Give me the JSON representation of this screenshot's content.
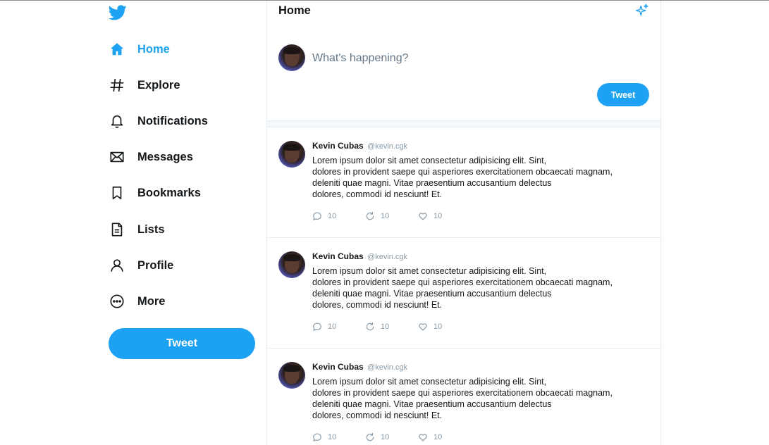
{
  "sidebar": {
    "items": [
      {
        "label": "Home",
        "icon": "home-icon"
      },
      {
        "label": "Explore",
        "icon": "hashtag-icon"
      },
      {
        "label": "Notifications",
        "icon": "bell-icon"
      },
      {
        "label": "Messages",
        "icon": "envelope-icon"
      },
      {
        "label": "Bookmarks",
        "icon": "bookmark-icon"
      },
      {
        "label": "Lists",
        "icon": "document-icon"
      },
      {
        "label": "Profile",
        "icon": "user-icon"
      },
      {
        "label": "More",
        "icon": "more-icon"
      }
    ],
    "tweet_button": "Tweet"
  },
  "header": {
    "title": "Home"
  },
  "composer": {
    "placeholder": "What's happening?",
    "tweet_button": "Tweet"
  },
  "colors": {
    "accent": "#1da1f2",
    "text": "#14171a",
    "muted": "#8899a6"
  },
  "tweets": [
    {
      "name": "Kevin Cubas",
      "handle": "@kevin.cgk",
      "lines": [
        "Lorem ipsum dolor sit amet consectetur adipisicing elit. Sint,",
        "dolores in provident saepe qui asperiores exercitationem obcaecati magnam,",
        "deleniti quae magni. Vitae praesentium accusantium delectus",
        "dolores, commodi id nesciunt! Et."
      ],
      "replies": "10",
      "retweets": "10",
      "likes": "10"
    },
    {
      "name": "Kevin Cubas",
      "handle": "@kevin.cgk",
      "lines": [
        "Lorem ipsum dolor sit amet consectetur adipisicing elit. Sint,",
        "dolores in provident saepe qui asperiores exercitationem obcaecati magnam,",
        "deleniti quae magni. Vitae praesentium accusantium delectus",
        "dolores, commodi id nesciunt! Et."
      ],
      "replies": "10",
      "retweets": "10",
      "likes": "10"
    },
    {
      "name": "Kevin Cubas",
      "handle": "@kevin.cgk",
      "lines": [
        "Lorem ipsum dolor sit amet consectetur adipisicing elit. Sint,",
        "dolores in provident saepe qui asperiores exercitationem obcaecati magnam,",
        "deleniti quae magni. Vitae praesentium accusantium delectus",
        "dolores, commodi id nesciunt! Et."
      ],
      "replies": "10",
      "retweets": "10",
      "likes": "10"
    }
  ]
}
